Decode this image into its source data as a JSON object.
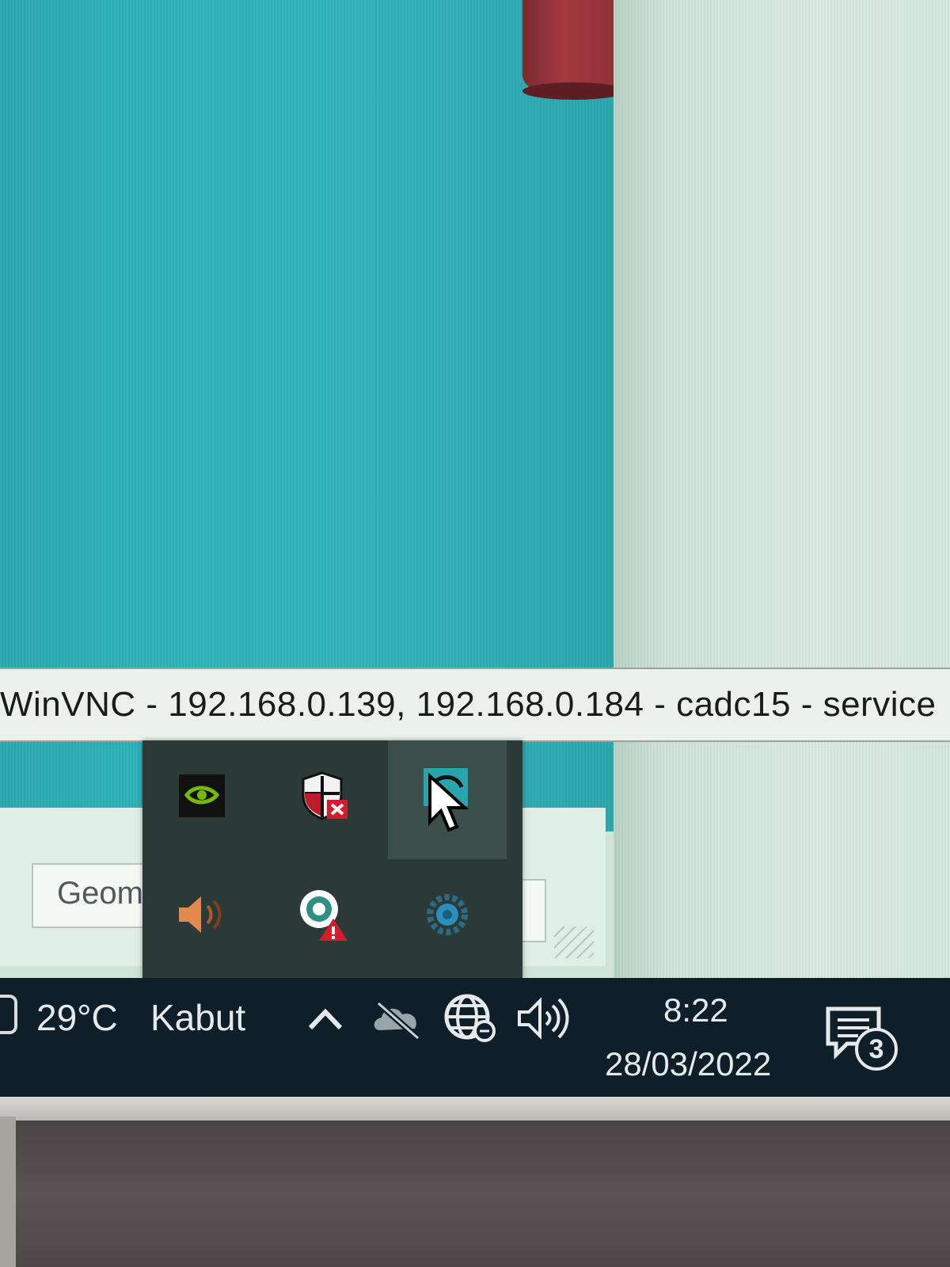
{
  "tooltip": {
    "text": "WinVNC - 192.168.0.139, 192.168.0.184 - cadc15 - service"
  },
  "dialog": {
    "field_text": "Geom"
  },
  "tray_flyout": {
    "icons": [
      "nvidia-icon",
      "windows-security-icon",
      "winvnc-icon",
      "speaker-icon",
      "app-warning-icon",
      "settings-gear-icon"
    ]
  },
  "taskbar": {
    "weather": {
      "temperature": "29°C",
      "condition": "Kabut"
    },
    "clock": {
      "time": "8:22",
      "date": "28/03/2022"
    },
    "notifications": {
      "count": "3"
    }
  },
  "colors": {
    "teal": "#2eb4ba",
    "taskbar": "#0f1f2a",
    "flyout": "#2b3a36",
    "nvidia_green": "#76b900"
  }
}
